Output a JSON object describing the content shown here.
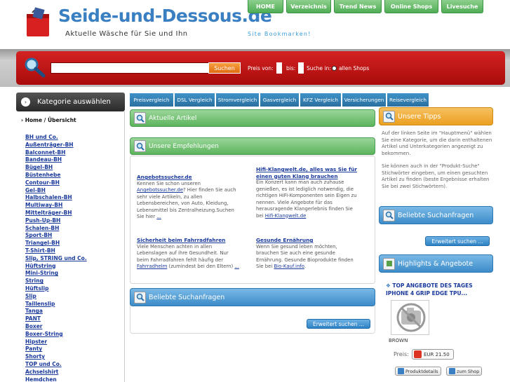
{
  "header": {
    "title": "Seide-und-Dessous.de",
    "subtitle": "Aktuelle Wäsche für Sie und Ihn",
    "bookmark": "Site Bookmarken!",
    "nav": [
      "HOME",
      "Verzeichnis",
      "Trend News",
      "Online Shops",
      "Livesuche"
    ]
  },
  "search": {
    "button": "Suchen",
    "preis_von": "Preis von:",
    "bis": "bis:",
    "suche_in": "Suche in:",
    "option": "allen Shops"
  },
  "sidebar": {
    "heading": "Kategorie auswählen",
    "home": "Home / Übersicht",
    "categories": [
      "BH und Co.",
      "Außenträger-BH",
      "Balconnet-BH",
      "Bandeau-BH",
      "Bügel-BH",
      "Büstenhebe",
      "Contour-BH",
      "Gel-BH",
      "Halbschalen-BH",
      "Multiway-BH",
      "Mittelträger-BH",
      "Push-Up-BH",
      "Schalen-BH",
      "Sport-BH",
      "Triangel-BH",
      "T-Shirt-BH",
      "Slip, STRING und Co.",
      "Hüftstring",
      "Mini-String",
      "String",
      "Hüftslip",
      "Slip",
      "Taillenslip",
      "Tanga",
      "PANT",
      "Boxer",
      "Boxer-String",
      "Hipster",
      "Panty",
      "Shorty",
      "TOP und Co.",
      "Achselshirt",
      "Hemdchen"
    ]
  },
  "tabs": [
    "Preisvergleich",
    "DSL Vergleich",
    "Stromvergleich",
    "Gasvergleich",
    "KFZ Vergleich",
    "Versicherungen",
    "Reisevergleich"
  ],
  "main": {
    "aktuelle": "Aktuelle Artikel",
    "empfehlungen": "Unsere Empfehlungen",
    "articles": [
      {
        "title": "Angebotssucher.de",
        "body": "Kennen Sie schon unseren",
        "link": "Angebotssucher.de",
        "body2": "? Hier finden Sie auch sehr viele Artikeln, zu allen Lebensbereichen, von Auto, Kleidung, Lebensmittel bis Zentralheizung.Suchen Sie hier",
        "more": "..."
      },
      {
        "title": "Hifi-Klangwelt.de, alles was Sie für einen guten Klang brauchen",
        "body": "Ein Konzert kann man auch zuhause genießen, es ist lediglich notwendig, die richtigen HiFi-Komponenten sein Eigen zu nennen. Viele Angebote für das herausragende Klangerlebnis finden Sie bei",
        "link": "Hifi-Klangwelt.de"
      },
      {
        "title": "Sicherheit beim Fahrradfahren",
        "body": "Viele Menschen achten in allen Lebenslagen auf ihre Gesundheit. Nur beim Fahrradfahren fehlt häufig der",
        "link": "Fahrradhelm",
        "body2": "(zumindest bei den Eltern)",
        "more": "..."
      },
      {
        "title": "Gesunde Ernährung",
        "body": "Wenn Sie gesund leben möchten, brauchen Sie auch eine gesunde Ernährung. Gesunde Bioprodukte finden Sie bei",
        "link": "Bio-Kauf.info",
        "body2": "."
      }
    ],
    "beliebte": "Beliebte Suchanfragen",
    "erweitert": "Erweitert suchen ..."
  },
  "right": {
    "tipps_title": "Unsere Tipps",
    "tipps_text1": "Auf der linken Seite im \"Hauptmenü\" wählen Sie eine Kategorie, um die darin enthaltenen Artikel und Unterkategorien angezeigt zu bekommen.",
    "tipps_text2": "Sie können auch in der \"Produkt-Suche\" Stichwörter eingeben, um einen gesuchten Artikel zu finden (beste Ergebnisse erhalten Sie bei zwei Stichwörtern).",
    "beliebte": "Beliebte Suchanfragen",
    "erweitert": "Erweitert suchen ...",
    "highlights": "Highlights & Angebote",
    "top_label": "TOP ANGEBOTE DES TAGES",
    "product": "IPHONE 4 GRIP EDGE TPU...",
    "color": "BROWN",
    "preis": "Preis:",
    "price": "EUR 21.50",
    "details": "Produktdetails",
    "shop": "zum Shop"
  },
  "colors": {
    "accent_red": "#c41818",
    "accent_green": "#5cb45c",
    "accent_blue": "#2f82c4",
    "accent_orange": "#eba021"
  }
}
